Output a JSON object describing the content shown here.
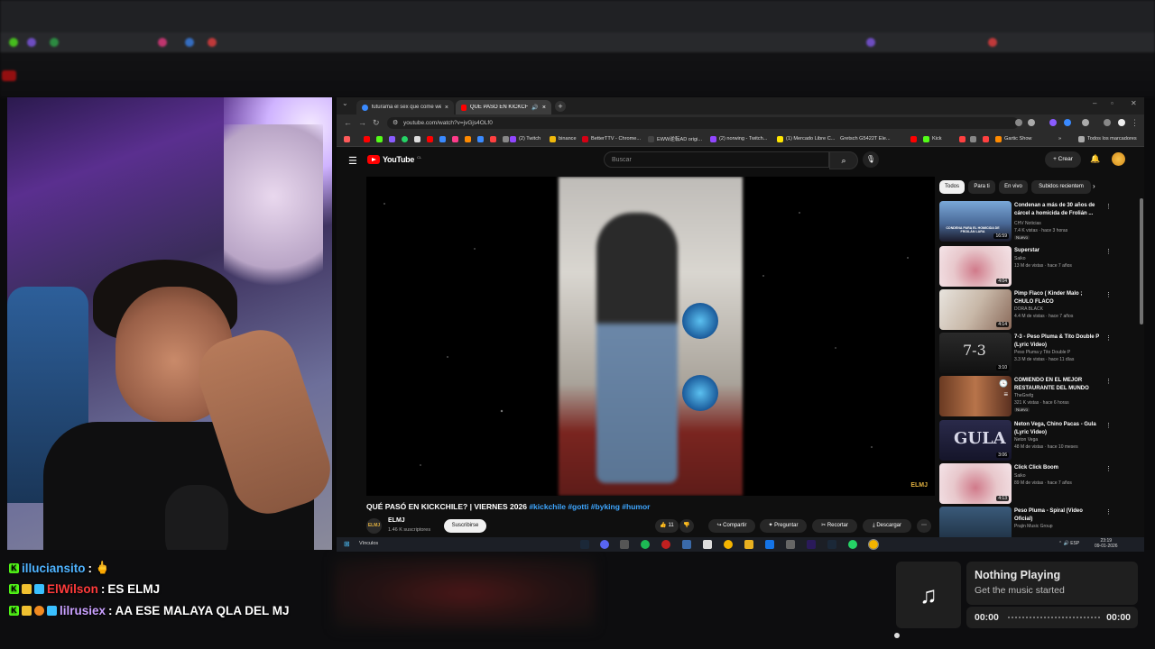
{
  "browser": {
    "tabs": [
      {
        "label": "futurama el sex que come wea",
        "active": false
      },
      {
        "label": "QUÉ PASÓ EN KICKCHILE?",
        "active": true
      }
    ],
    "url": "youtube.com/watch?v=jvGjs4OLf0",
    "bookmarks": [
      "(2) Twitch",
      "binance",
      "BetterTTV - Chrome...",
      "EWW逆転AD origi...",
      "(2) norwing - Twitch...",
      "(1) Mercado Libre C...",
      "Gretsch G5422T Ele...",
      "Kick",
      "Gartic Show",
      "Todos los marcadores"
    ]
  },
  "youtube": {
    "logo": "YouTube",
    "logo_country": "CL",
    "search_placeholder": "Buscar",
    "create_label": "Crear",
    "watermark": "ELMJ",
    "video_title": "QUÉ PASÓ EN KICKCHILE? | VIERNES 2026",
    "video_tags": "#kickchile #gotti #byking #humor",
    "channel_name": "ELMJ",
    "channel_subs": "1.46 K suscriptores",
    "subscribe_label": "Suscribirse",
    "like_count": "11",
    "actions": [
      "Compartir",
      "Preguntar",
      "Recortar",
      "Descargar"
    ],
    "chips": [
      "Todos",
      "Para ti",
      "En vivo",
      "Subidos recientem"
    ],
    "recommendations": [
      {
        "title": "Condenan a más de 30 años de cárcel a homicida de Frolián ...",
        "channel": "CHV Noticias",
        "meta": "7.4 K vistas · hace 3 horas",
        "badge": "Nuevo",
        "duration": "16:59",
        "thumb_text": "CONDENA PARA EL HOMICIDA DE FROILÁN LARA"
      },
      {
        "title": "Superstar",
        "channel": "Saiko",
        "meta": "13 M de vistas · hace 7 años",
        "badge": "",
        "duration": "4:04",
        "thumb_text": ""
      },
      {
        "title": "Pimp Flaco ( Kinder Malo ; CHULO FLACO",
        "channel": "DORA BLACK",
        "meta": "4.4 M de vistas · hace 7 años",
        "badge": "",
        "duration": "4:14",
        "thumb_text": ""
      },
      {
        "title": "7-3 - Peso Pluma & Tito Double P (Lyric Video)",
        "channel": "Peso Pluma y Tito Double P",
        "meta": "3.3 M de vistas · hace 11 días",
        "badge": "",
        "duration": "3:10",
        "thumb_text": "7-3"
      },
      {
        "title": "COMIENDO EN EL MEJOR RESTAURANTE DEL MUNDO",
        "channel": "TheGrefg",
        "meta": "321 K vistas · hace 6 horas",
        "badge": "Nuevo",
        "duration": "",
        "thumb_text": ""
      },
      {
        "title": "Neton Vega, Chino Pacas - Gula (Lyric Video)",
        "channel": "Neton Vega",
        "meta": "48 M de vistas · hace 10 meses",
        "badge": "",
        "duration": "3:06",
        "thumb_text": "GULA"
      },
      {
        "title": "Click Click Boom",
        "channel": "Saiko",
        "meta": "89 M de vistas · hace 7 años",
        "badge": "",
        "duration": "4:13",
        "thumb_text": ""
      },
      {
        "title": "Peso Pluma - Spiral (Video Oficial)",
        "channel": "Prajin Music Group",
        "meta": "",
        "badge": "",
        "duration": "",
        "thumb_text": ""
      }
    ]
  },
  "taskbar": {
    "links_label": "Vínculos",
    "lang": "ESP",
    "time": "23:19",
    "date": "09-01-2026"
  },
  "chat": [
    {
      "user": "illuciansito",
      "user_color": "#4fb3ff",
      "message": "🖕"
    },
    {
      "user": "ElWilson",
      "user_color": "#ff3b3b",
      "message": "ES ELMJ"
    },
    {
      "user": "lilrusiex",
      "user_color": "#c9a0ff",
      "message": "AA ESE MALAYA QLA DEL MJ"
    }
  ],
  "music": {
    "title": "Nothing Playing",
    "subtitle": "Get the music started",
    "time_start": "00:00",
    "time_end": "00:00",
    "progress_fraction": 0
  }
}
